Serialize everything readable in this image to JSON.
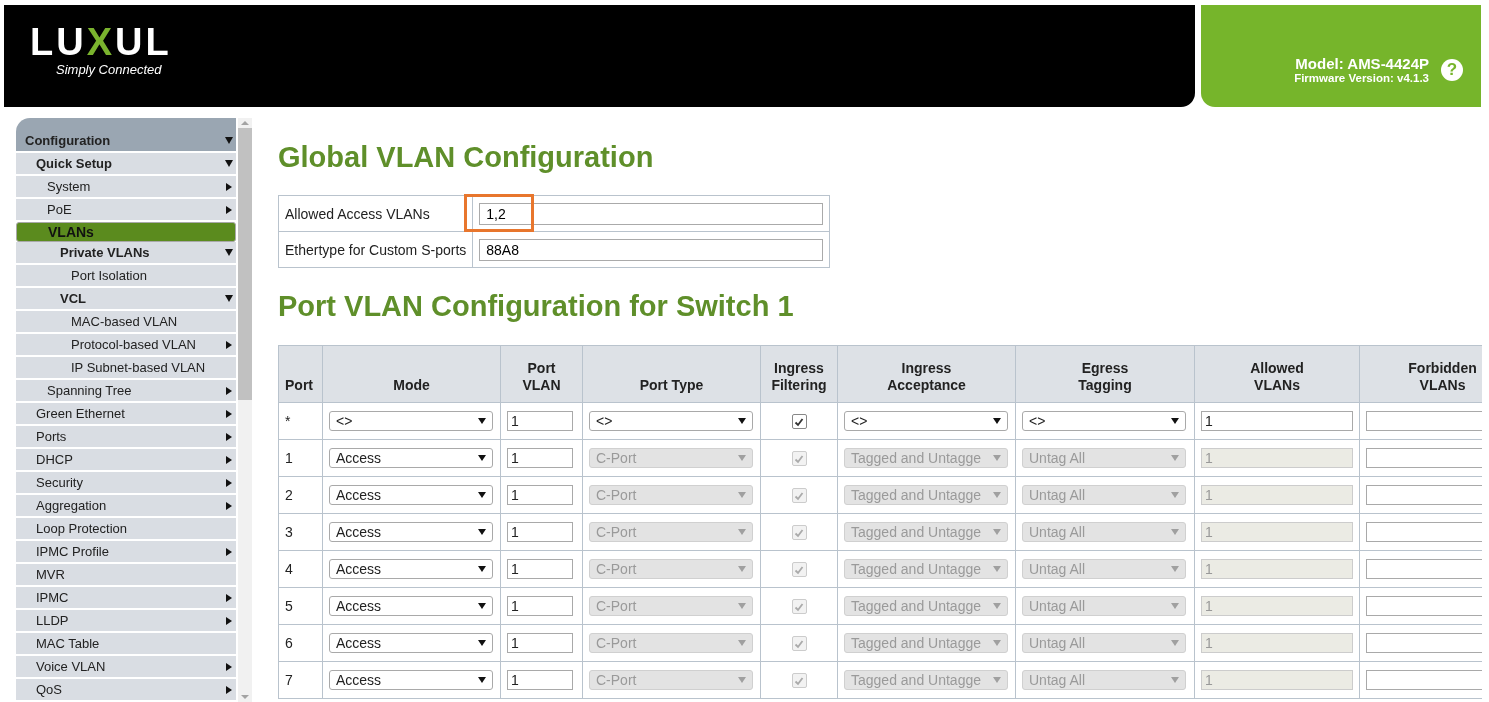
{
  "header": {
    "logo": {
      "name": "LUXUL",
      "tagline": "Simply Connected"
    },
    "model": "Model: AMS-4424P",
    "firmware": "Firmware Version: v4.1.3",
    "help": "?"
  },
  "sidebar": {
    "items": [
      {
        "label": "Configuration",
        "kind": "folder",
        "expanded": true,
        "selected": false,
        "children": [
          {
            "label": "Quick Setup",
            "kind": "folder",
            "expanded": true,
            "selected": false,
            "children": [
              {
                "label": "System",
                "kind": "folder",
                "expanded": false,
                "selected": false
              },
              {
                "label": "PoE",
                "kind": "folder",
                "expanded": false,
                "selected": false
              },
              {
                "label": "VLANs",
                "kind": "page",
                "selected": true,
                "children": [
                  {
                    "label": "Private VLANs",
                    "kind": "folder",
                    "expanded": true,
                    "selected": false,
                    "children": [
                      {
                        "label": "Port Isolation",
                        "kind": "page",
                        "selected": false
                      }
                    ]
                  },
                  {
                    "label": "VCL",
                    "kind": "folder",
                    "expanded": true,
                    "selected": false,
                    "children": [
                      {
                        "label": "MAC-based VLAN",
                        "kind": "page",
                        "selected": false
                      },
                      {
                        "label": "Protocol-based VLAN",
                        "kind": "folder",
                        "expanded": false,
                        "selected": false
                      },
                      {
                        "label": "IP Subnet-based VLAN",
                        "kind": "page",
                        "selected": false
                      }
                    ]
                  }
                ]
              },
              {
                "label": "Spanning Tree",
                "kind": "folder",
                "expanded": false,
                "selected": false
              }
            ]
          },
          {
            "label": "Green Ethernet",
            "kind": "folder",
            "expanded": false,
            "selected": false
          },
          {
            "label": "Ports",
            "kind": "folder",
            "expanded": false,
            "selected": false
          },
          {
            "label": "DHCP",
            "kind": "folder",
            "expanded": false,
            "selected": false
          },
          {
            "label": "Security",
            "kind": "folder",
            "expanded": false,
            "selected": false
          },
          {
            "label": "Aggregation",
            "kind": "folder",
            "expanded": false,
            "selected": false
          },
          {
            "label": "Loop Protection",
            "kind": "page",
            "selected": false
          },
          {
            "label": "IPMC Profile",
            "kind": "folder",
            "expanded": false,
            "selected": false
          },
          {
            "label": "MVR",
            "kind": "page",
            "selected": false
          },
          {
            "label": "IPMC",
            "kind": "folder",
            "expanded": false,
            "selected": false
          },
          {
            "label": "LLDP",
            "kind": "folder",
            "expanded": false,
            "selected": false
          },
          {
            "label": "MAC Table",
            "kind": "page",
            "selected": false
          },
          {
            "label": "Voice VLAN",
            "kind": "folder",
            "expanded": false,
            "selected": false
          },
          {
            "label": "QoS",
            "kind": "folder",
            "expanded": false,
            "selected": false
          }
        ]
      }
    ]
  },
  "global": {
    "title": "Global VLAN Configuration",
    "rows": [
      {
        "label": "Allowed Access VLANs",
        "value": "1,2",
        "highlighted": true
      },
      {
        "label": "Ethertype for Custom S-ports",
        "value": "88A8",
        "highlighted": false
      }
    ]
  },
  "port_table": {
    "title": "Port VLAN Configuration for Switch 1",
    "columns": [
      [
        "Port"
      ],
      [
        "Mode"
      ],
      [
        "Port",
        "VLAN"
      ],
      [
        "Port Type"
      ],
      [
        "Ingress",
        "Filtering"
      ],
      [
        "Ingress",
        "Acceptance"
      ],
      [
        "Egress",
        "Tagging"
      ],
      [
        "Allowed",
        "VLANs"
      ],
      [
        "Forbidden",
        "VLANs"
      ]
    ],
    "rows": [
      {
        "port": "*",
        "mode": "<>",
        "port_vlan": "1",
        "port_type": "<>",
        "ingress_filtering": true,
        "ingress_acceptance": "<>",
        "egress_tagging": "<>",
        "allowed_vlans": "1",
        "disabled": false
      },
      {
        "port": "1",
        "mode": "Access",
        "port_vlan": "1",
        "port_type": "C-Port",
        "ingress_filtering": true,
        "ingress_acceptance": "Tagged and Untagge",
        "egress_tagging": "Untag All",
        "allowed_vlans": "1",
        "disabled": true
      },
      {
        "port": "2",
        "mode": "Access",
        "port_vlan": "1",
        "port_type": "C-Port",
        "ingress_filtering": true,
        "ingress_acceptance": "Tagged and Untagge",
        "egress_tagging": "Untag All",
        "allowed_vlans": "1",
        "disabled": true
      },
      {
        "port": "3",
        "mode": "Access",
        "port_vlan": "1",
        "port_type": "C-Port",
        "ingress_filtering": true,
        "ingress_acceptance": "Tagged and Untagge",
        "egress_tagging": "Untag All",
        "allowed_vlans": "1",
        "disabled": true
      },
      {
        "port": "4",
        "mode": "Access",
        "port_vlan": "1",
        "port_type": "C-Port",
        "ingress_filtering": true,
        "ingress_acceptance": "Tagged and Untagge",
        "egress_tagging": "Untag All",
        "allowed_vlans": "1",
        "disabled": true
      },
      {
        "port": "5",
        "mode": "Access",
        "port_vlan": "1",
        "port_type": "C-Port",
        "ingress_filtering": true,
        "ingress_acceptance": "Tagged and Untagge",
        "egress_tagging": "Untag All",
        "allowed_vlans": "1",
        "disabled": true
      },
      {
        "port": "6",
        "mode": "Access",
        "port_vlan": "1",
        "port_type": "C-Port",
        "ingress_filtering": true,
        "ingress_acceptance": "Tagged and Untagge",
        "egress_tagging": "Untag All",
        "allowed_vlans": "1",
        "disabled": true
      },
      {
        "port": "7",
        "mode": "Access",
        "port_vlan": "1",
        "port_type": "C-Port",
        "ingress_filtering": true,
        "ingress_acceptance": "Tagged and Untagge",
        "egress_tagging": "Untag All",
        "allowed_vlans": "1",
        "disabled": true
      }
    ]
  }
}
